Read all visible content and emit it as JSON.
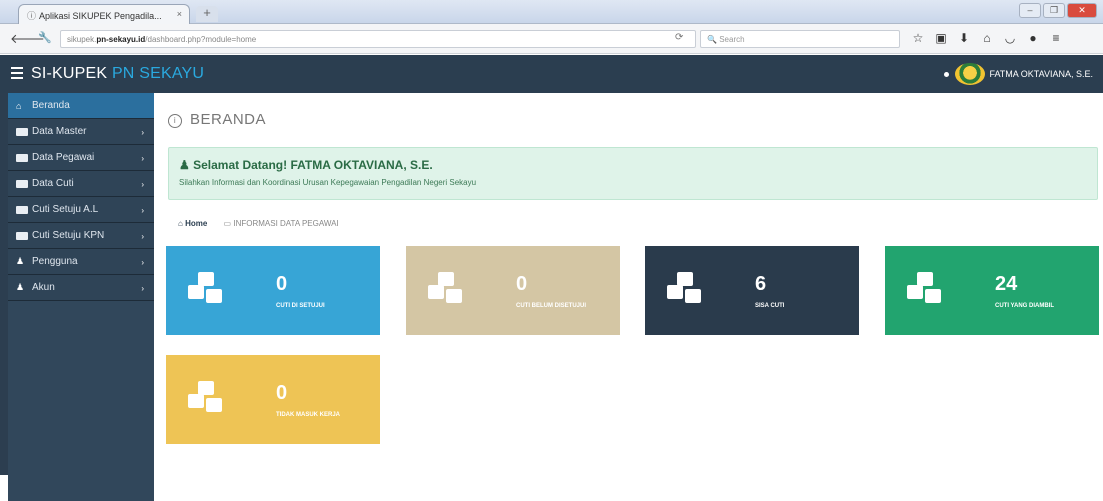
{
  "browser": {
    "tab_title": "Aplikasi SIKUPEK Pengadila...",
    "tab_close": "×",
    "new_tab": "+",
    "url_prefix": "sikupek.",
    "url_domain": "pn-sekayu.id",
    "url_path": "/dashboard.php?module=home",
    "search_placeholder": "Search",
    "window_controls": [
      "–",
      "❐",
      "✕"
    ],
    "toolbar_icons": [
      "star-icon",
      "clipboard-icon",
      "download-icon",
      "home-icon",
      "pocket-icon",
      "chat-icon",
      "menu-icon"
    ]
  },
  "app": {
    "brand_prefix": "SI-KUPEK ",
    "brand_highlight": "PN SEKAYU",
    "user_name": "FATMA OKTAVIANA, S.E."
  },
  "sidebar": {
    "items": [
      {
        "label": "Beranda",
        "icon": "home-icon",
        "active": true
      },
      {
        "label": "Data Master",
        "icon": "card-icon"
      },
      {
        "label": "Data Pegawai",
        "icon": "card-icon"
      },
      {
        "label": "Data Cuti",
        "icon": "card-icon"
      },
      {
        "label": "Cuti Setuju A.L",
        "icon": "card-icon"
      },
      {
        "label": "Cuti Setuju KPN",
        "icon": "card-icon"
      },
      {
        "label": "Pengguna",
        "icon": "user-icon"
      },
      {
        "label": "Akun",
        "icon": "user-icon"
      }
    ]
  },
  "main": {
    "title": "BERANDA",
    "welcome_title": "Selamat Datang! FATMA OKTAVIANA, S.E.",
    "welcome_text": "Silahkan Informasi dan Koordinasi Urusan Kepegawaian Pengadilan Negeri Sekayu",
    "breadcrumb_home": "Home",
    "breadcrumb_current": "INFORMASI DATA PEGAWAI",
    "stats": [
      {
        "value": "0",
        "label": "CUTI DI SETUJUI",
        "color": "#37a5d6"
      },
      {
        "value": "0",
        "label": "CUTI BELUM DISETUJUI",
        "color": "#d4c6a4"
      },
      {
        "value": "6",
        "label": "SISA CUTI",
        "color": "#2a3b4c"
      },
      {
        "value": "24",
        "label": "CUTI YANG DIAMBIL",
        "color": "#22a46f"
      },
      {
        "value": "0",
        "label": "TIDAK MASUK KERJA",
        "color": "#eec455"
      }
    ]
  }
}
